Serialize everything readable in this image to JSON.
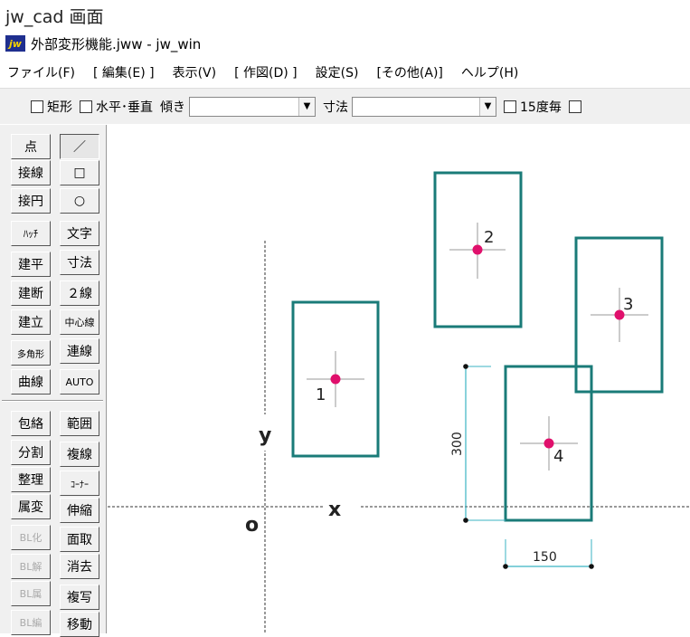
{
  "caption": "jw_cad 画面",
  "window": {
    "icon_label": "jw",
    "title": "外部変形機能.jww - jw_win"
  },
  "menu": [
    "ファイル(F)",
    "[ 編集(E) ]",
    "表示(V)",
    "[ 作図(D) ]",
    "設定(S)",
    "[その他(A)]",
    "ヘルプ(H)"
  ],
  "toolbar": {
    "rect_label": "矩形",
    "hv_label": "水平･垂直",
    "tilt_label": "傾き",
    "dim_label": "寸法",
    "deg15_label": "15度毎",
    "arrow": "▼"
  },
  "tools_left": [
    "点",
    "接線",
    "接円",
    "ﾊｯﾁ",
    "建平",
    "建断",
    "建立",
    "多角形",
    "曲線",
    "包絡",
    "分割",
    "整理",
    "属変",
    "BL化",
    "BL解",
    "BL属",
    "BL編"
  ],
  "tools_right": [
    "／",
    "□",
    "○",
    "文字",
    "寸法",
    "２線",
    "中心線",
    "連線",
    "AUTO",
    "範囲",
    "複線",
    "ｺｰﾅｰ",
    "伸縮",
    "面取",
    "消去",
    "複写",
    "移動"
  ],
  "drawing": {
    "axis_x_label": "x",
    "axis_y_label": "y",
    "origin_label": "o",
    "points": [
      "1",
      "2",
      "3",
      "4"
    ],
    "dim_vertical": "300",
    "dim_horizontal": "150",
    "colors": {
      "rect": "#1a7b78",
      "point": "#e0106c",
      "dim": "#3bb3c3",
      "cross": "#9a9a9a"
    }
  }
}
